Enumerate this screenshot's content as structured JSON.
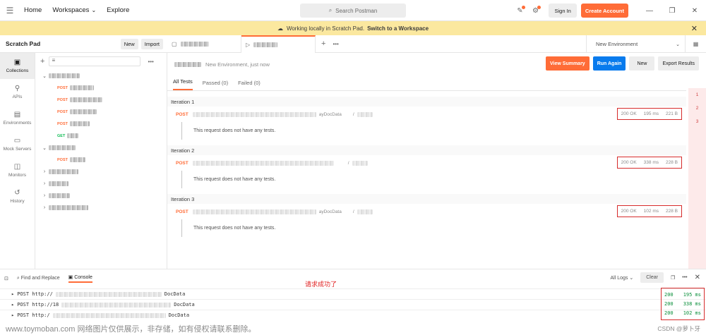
{
  "topbar": {
    "nav": [
      "Home",
      "Workspaces",
      "Explore"
    ],
    "search_placeholder": "Search Postman",
    "sign_in": "Sign In",
    "create_account": "Create Account"
  },
  "banner": {
    "text": "Working locally in Scratch Pad.",
    "link": "Switch to a Workspace"
  },
  "sidebar": {
    "title": "Scratch Pad",
    "new": "New",
    "import": "Import",
    "rail": [
      "Collections",
      "APIs",
      "Environments",
      "Mock Servers",
      "Monitors",
      "History"
    ],
    "tree": [
      {
        "type": "folder",
        "open": true
      },
      {
        "type": "request",
        "method": "POST"
      },
      {
        "type": "request",
        "method": "POST"
      },
      {
        "type": "request",
        "method": "POST"
      },
      {
        "type": "request",
        "method": "POST"
      },
      {
        "type": "request",
        "method": "GET"
      },
      {
        "type": "folder",
        "open": true
      },
      {
        "type": "request",
        "method": "POST"
      },
      {
        "type": "folder",
        "open": false
      },
      {
        "type": "folder",
        "open": false
      },
      {
        "type": "folder",
        "open": false
      },
      {
        "type": "folder",
        "open": false
      }
    ]
  },
  "tabs": {
    "environment": "New Environment"
  },
  "runner": {
    "env_text": "New Environment, just now",
    "view_summary": "View Summary",
    "run_again": "Run Again",
    "new": "New",
    "export": "Export Results",
    "filter_tabs": [
      "All Tests",
      "Passed (0)",
      "Failed (0)"
    ],
    "iterations": [
      {
        "label": "Iteration 1",
        "method": "POST",
        "url_tail": "ayDocData",
        "status": "200 OK",
        "time": "195 ms",
        "size": "221 B",
        "note": "This request does not have any tests."
      },
      {
        "label": "Iteration 2",
        "method": "POST",
        "url_tail": "",
        "status": "200 OK",
        "time": "338 ms",
        "size": "228 B",
        "note": "This request does not have any tests."
      },
      {
        "label": "Iteration 3",
        "method": "POST",
        "url_tail": "ayDocData",
        "status": "200 OK",
        "time": "102 ms",
        "size": "228 B",
        "note": "This request does not have any tests."
      }
    ],
    "pager": [
      "1",
      "2",
      "3"
    ]
  },
  "console": {
    "find_replace": "Find and Replace",
    "console": "Console",
    "annotation": "请求成功了",
    "all_logs": "All Logs",
    "clear": "Clear",
    "logs": [
      {
        "prefix": "POST http://",
        "suffix": "DocData",
        "status": "200",
        "time": "195 ms"
      },
      {
        "prefix": "POST http://18",
        "suffix": "DocData",
        "status": "200",
        "time": "338 ms"
      },
      {
        "prefix": "POST http:/",
        "suffix": "DocData",
        "status": "200",
        "time": "102 ms"
      }
    ]
  },
  "footer": {
    "watermark": "www.toymoban.com 网络图片仅供展示，非存储，如有侵权请联系删除。",
    "credit": "CSDN @萝卜牙"
  }
}
